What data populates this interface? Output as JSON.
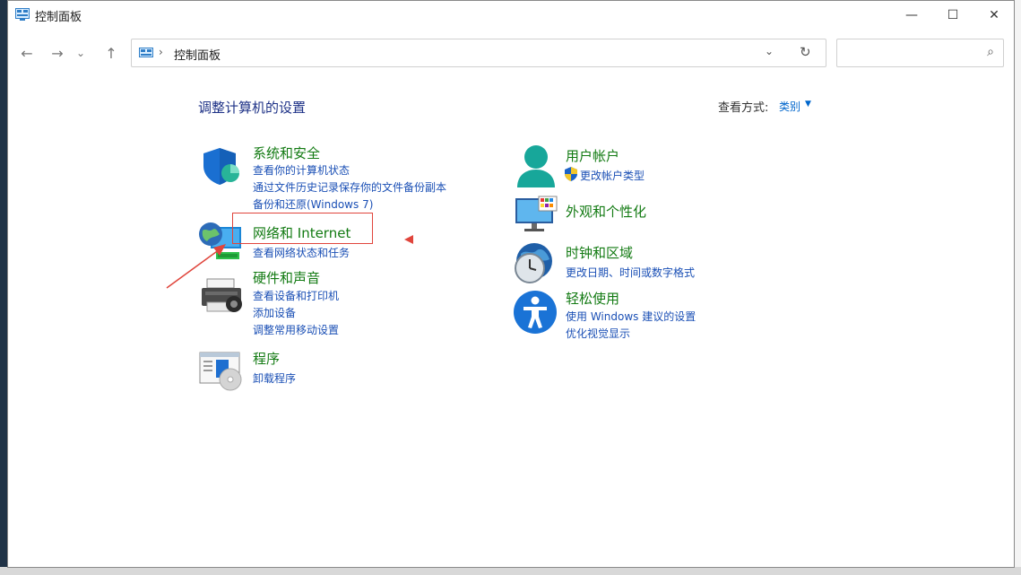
{
  "window": {
    "title": "控制面板",
    "controls": {
      "minimize": "—",
      "maximize": "☐",
      "close": "✕"
    }
  },
  "nav": {
    "back": "←",
    "forward": "→",
    "recent": "⌄",
    "up": "↑",
    "breadcrumb_sep": "›",
    "breadcrumb": "控制面板",
    "dropdown": "⌄",
    "refresh": "↻",
    "search_icon": "⌕",
    "search_placeholder": ""
  },
  "main": {
    "heading": "调整计算机的设置",
    "view_by_label": "查看方式:",
    "view_by_value": "类别",
    "view_by_caret": "▼"
  },
  "categories_left": [
    {
      "title": "系统和安全",
      "icon": "shield-icon",
      "links": [
        "查看你的计算机状态",
        "通过文件历史记录保存你的文件备份副本",
        "备份和还原(Windows 7)"
      ]
    },
    {
      "title": "网络和 Internet",
      "icon": "globe-network-icon",
      "links": [
        "查看网络状态和任务"
      ]
    },
    {
      "title": "硬件和声音",
      "icon": "printer-icon",
      "links": [
        "查看设备和打印机",
        "添加设备",
        "调整常用移动设置"
      ]
    },
    {
      "title": "程序",
      "icon": "programs-icon",
      "links": [
        "卸载程序"
      ]
    }
  ],
  "categories_right": [
    {
      "title": "用户帐户",
      "icon": "user-icon",
      "links": [
        "更改帐户类型"
      ]
    },
    {
      "title": "外观和个性化",
      "icon": "monitor-icon",
      "links": []
    },
    {
      "title": "时钟和区域",
      "icon": "clock-globe-icon",
      "links": [
        "更改日期、时间或数字格式"
      ]
    },
    {
      "title": "轻松使用",
      "icon": "accessibility-icon",
      "links": [
        "使用 Windows 建议的设置",
        "优化视觉显示"
      ]
    }
  ],
  "colors": {
    "heading": "#1e3287",
    "category_title": "#127a12",
    "link": "#1a4fb5",
    "annotation": "#e0453c"
  }
}
